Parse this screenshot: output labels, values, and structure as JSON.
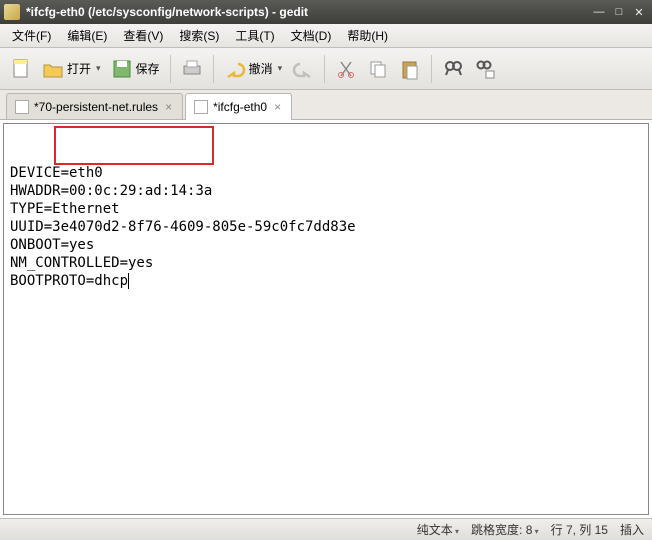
{
  "window": {
    "title": "*ifcfg-eth0 (/etc/sysconfig/network-scripts) - gedit"
  },
  "menus": {
    "file": "文件(F)",
    "edit": "编辑(E)",
    "view": "查看(V)",
    "search": "搜索(S)",
    "tools": "工具(T)",
    "documents": "文档(D)",
    "help": "帮助(H)"
  },
  "toolbar": {
    "open": "打开",
    "save": "保存",
    "undo": "撤消"
  },
  "tabs": {
    "t1": "*70-persistent-net.rules",
    "t2": "*ifcfg-eth0"
  },
  "editor": {
    "l1a": "DEVICE",
    "l1b": "=eth0",
    "l2a": "HWADDR",
    "l2b": "=00:0c:29:ad:14:3a",
    "l3": "TYPE=Ethernet",
    "l4": "UUID=3e4070d2-8f76-4609-805e-59c0fc7dd83e",
    "l5": "ONBOOT=yes",
    "l6": "NM_CONTROLLED=yes",
    "l7": "BOOTPROTO=dhcp"
  },
  "status": {
    "filetype": "纯文本",
    "tabwidth_label": "跳格宽度:",
    "tabwidth_val": "8",
    "linecol": "行 7, 列 15",
    "ins": "插入"
  }
}
